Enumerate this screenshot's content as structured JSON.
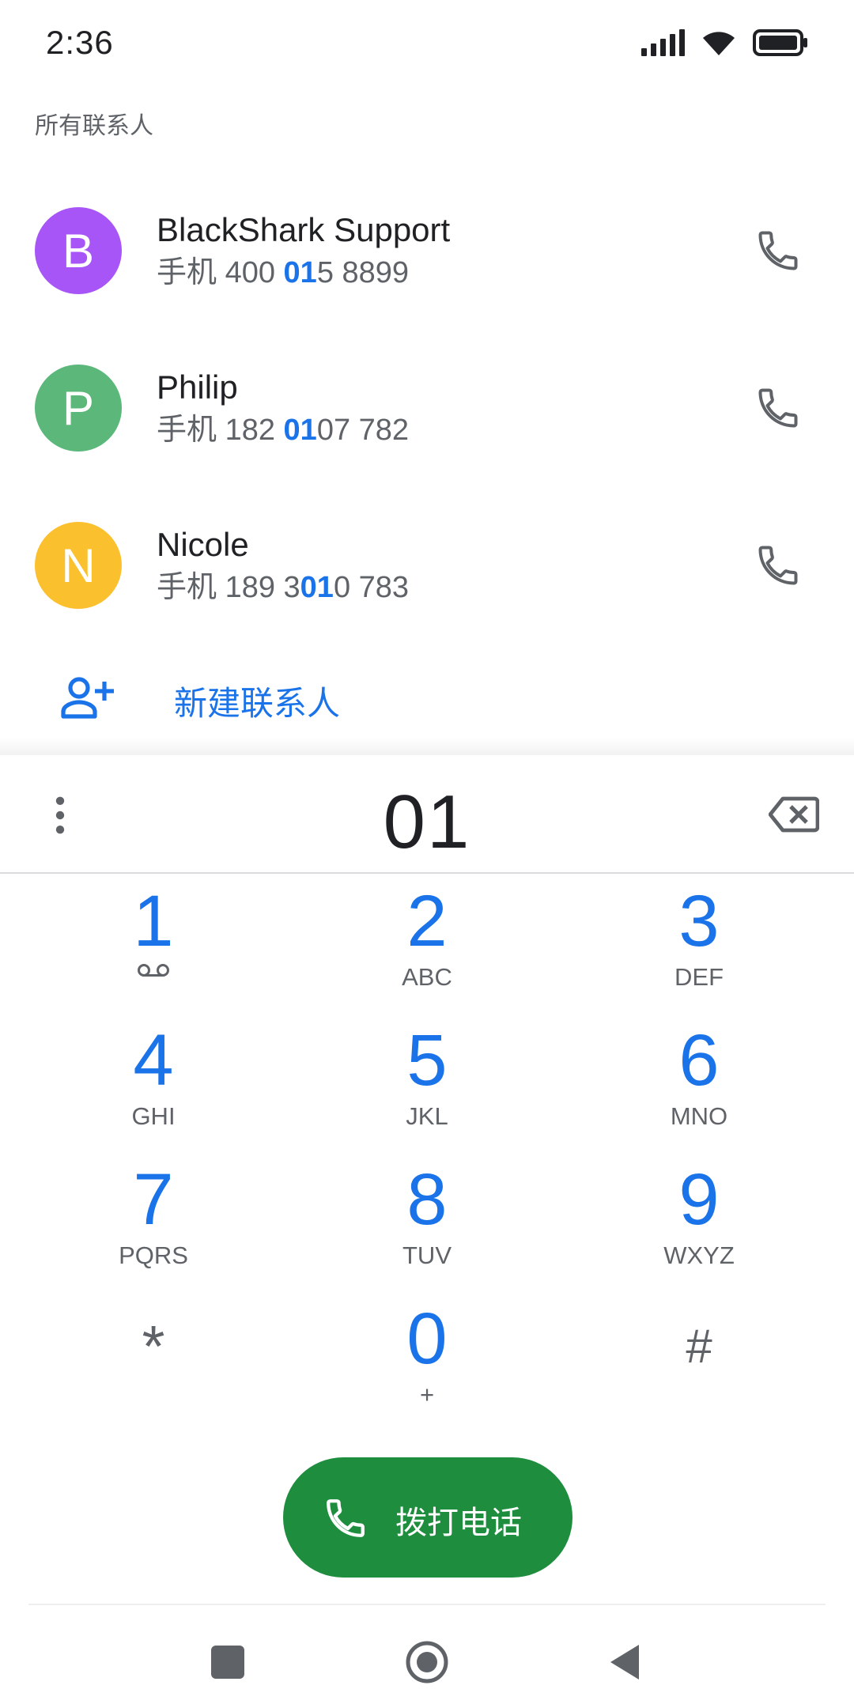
{
  "status_bar": {
    "time": "2:36"
  },
  "section_title": "所有联系人",
  "contacts": [
    {
      "initial": "B",
      "name": "BlackShark Support",
      "label": "手机",
      "num_pre": "400 ",
      "num_hl": "01",
      "num_post": "5 8899",
      "color": "#a855f7"
    },
    {
      "initial": "P",
      "name": "Philip",
      "label": "手机",
      "num_pre": "182 ",
      "num_hl": "01",
      "num_post": "07 782",
      "color": "#5cb87a"
    },
    {
      "initial": "N",
      "name": "Nicole",
      "label": "手机",
      "num_pre": "189 3",
      "num_hl": "01",
      "num_post": "0 783",
      "color": "#fbc02d"
    }
  ],
  "new_contact_label": "新建联系人",
  "dialer": {
    "digits": "01",
    "keys": [
      {
        "digit": "1",
        "letters": ""
      },
      {
        "digit": "2",
        "letters": "ABC"
      },
      {
        "digit": "3",
        "letters": "DEF"
      },
      {
        "digit": "4",
        "letters": "GHI"
      },
      {
        "digit": "5",
        "letters": "JKL"
      },
      {
        "digit": "6",
        "letters": "MNO"
      },
      {
        "digit": "7",
        "letters": "PQRS"
      },
      {
        "digit": "8",
        "letters": "TUV"
      },
      {
        "digit": "9",
        "letters": "WXYZ"
      },
      {
        "digit": "*",
        "letters": ""
      },
      {
        "digit": "0",
        "letters": "+"
      },
      {
        "digit": "#",
        "letters": ""
      }
    ],
    "call_label": "拨打电话"
  },
  "colors": {
    "accent": "#1a73e8",
    "call_green": "#1e8e3e",
    "secondary_text": "#5f6368"
  }
}
